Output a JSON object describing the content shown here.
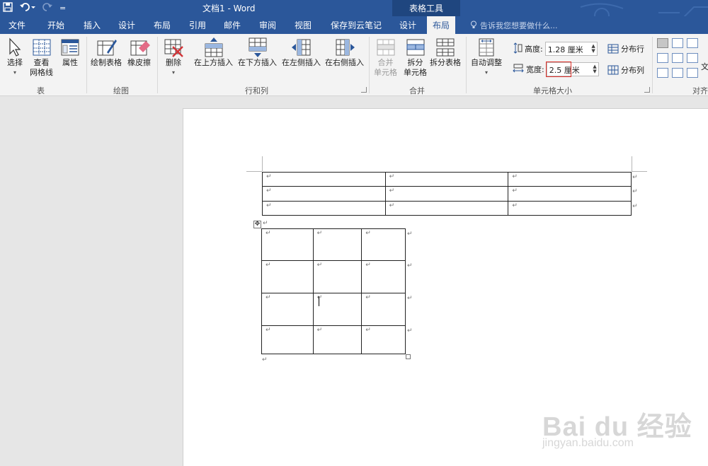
{
  "window": {
    "title": "文档1 - Word",
    "context_title": "表格工具"
  },
  "qat": {
    "save_icon": "save-icon",
    "undo_icon": "undo-icon",
    "redo_icon": "redo-icon",
    "customize": "="
  },
  "tabs": [
    "文件",
    "开始",
    "插入",
    "设计",
    "布局",
    "引用",
    "邮件",
    "审阅",
    "视图",
    "保存到云笔记",
    "设计",
    "布局"
  ],
  "tell_me": "告诉我您想要做什么...",
  "ribbon": {
    "groups": [
      "表",
      "绘图",
      "行和列",
      "合并",
      "单元格大小",
      "对齐"
    ],
    "table": {
      "select": "选择",
      "gridlines_1": "查看",
      "gridlines_2": "网格线",
      "properties": "属性"
    },
    "draw": {
      "draw_table": "绘制表格",
      "eraser": "橡皮擦"
    },
    "rows_cols": {
      "delete": "删除",
      "insert_above": "在上方插入",
      "insert_below": "在下方插入",
      "insert_left": "在左侧插入",
      "insert_right": "在右侧插入"
    },
    "merge": {
      "merge_cells_1": "合并",
      "merge_cells_2": "单元格",
      "split_cells_1": "拆分",
      "split_cells_2": "单元格",
      "split_table": "拆分表格"
    },
    "cell_size": {
      "autofit": "自动调整",
      "height_label": "高度:",
      "height_value": "1.28 厘米",
      "width_label": "宽度:",
      "width_value": "2.5 厘米",
      "distribute_rows": "分布行",
      "distribute_cols": "分布列"
    },
    "align": {
      "text_dir": "文"
    }
  },
  "document": {
    "mark": "↵",
    "table1": {
      "rows": 3,
      "cols": 3
    },
    "table2": {
      "rows": 4,
      "cols": 3
    }
  },
  "watermark": {
    "brand": "Bai du 经验",
    "url": "jingyan.baidu.com"
  },
  "colors": {
    "accent": "#2b579a",
    "context": "#1f467f",
    "highlight": "#e0302a"
  }
}
